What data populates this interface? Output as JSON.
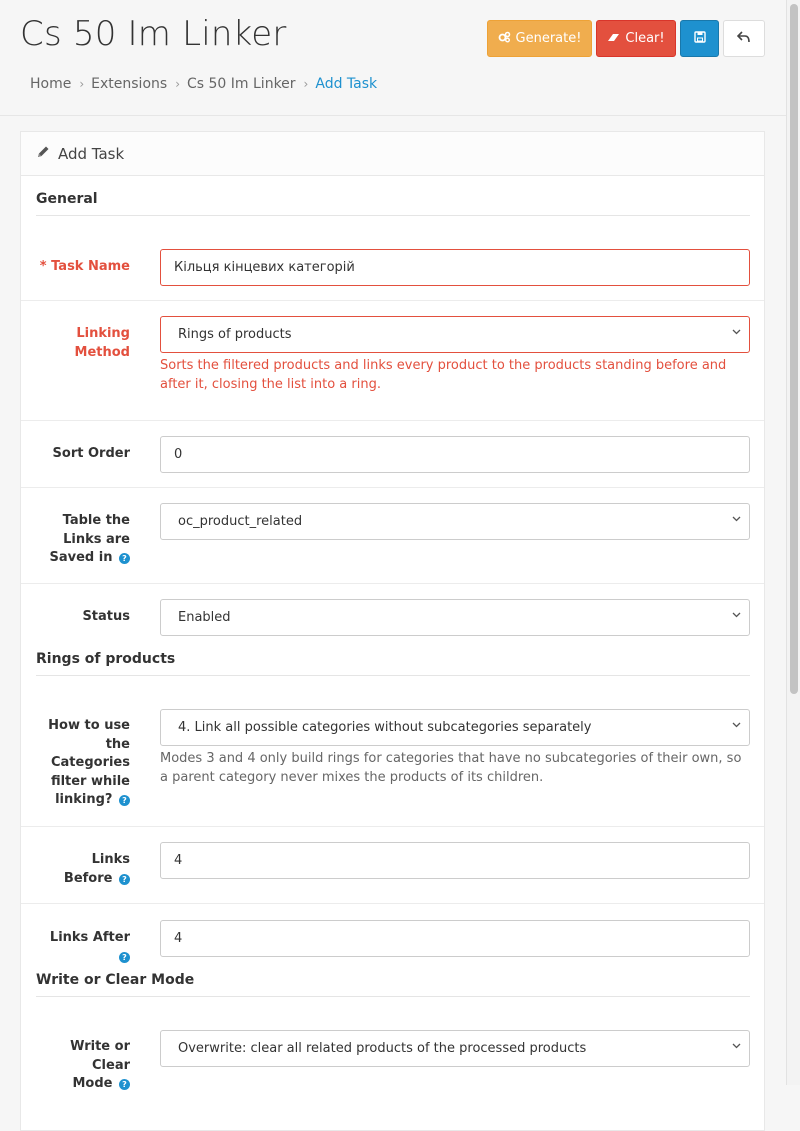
{
  "header": {
    "title": "Cs 50 Im Linker",
    "buttons": {
      "generate": "Generate!",
      "clear": "Clear!"
    },
    "breadcrumb": [
      "Home",
      "Extensions",
      "Cs 50 Im Linker",
      "Add Task"
    ]
  },
  "panel": {
    "heading": "Add Task",
    "sections": {
      "general": "General",
      "rings": "Rings of products",
      "write": "Write or Clear Mode"
    },
    "fields": {
      "task_name": {
        "label": "Task Name",
        "value": "Кільця кінцевих категорій"
      },
      "linking_method": {
        "label_line1": "Linking",
        "label_line2": "Method",
        "value": "Rings of products",
        "hint": "Sorts the filtered products and links every product to the products standing before and after it, closing the list into a ring."
      },
      "sort_order": {
        "label": "Sort Order",
        "value": "0"
      },
      "table": {
        "label_line1": "Table the",
        "label_line2": "Links are",
        "label_line3": "Saved in",
        "value": "oc_product_related"
      },
      "status": {
        "label": "Status",
        "value": "Enabled"
      },
      "categories_filter": {
        "label_line1": "How to use",
        "label_line2": "the",
        "label_line3": "Categories",
        "label_line4": "filter while",
        "label_line5": "linking?",
        "value": "4. Link all possible categories without subcategories separately",
        "hint": "Modes 3 and 4 only build rings for categories that have no subcategories of their own, so a parent category never mixes the products of its children."
      },
      "links_before": {
        "label_line1": "Links",
        "label_line2": "Before",
        "value": "4"
      },
      "links_after": {
        "label": "Links After",
        "value": "4"
      },
      "write_mode": {
        "label_line1": "Write or Clear",
        "label_line2": "Mode",
        "value": "Overwrite: clear all related products of the processed products"
      }
    }
  },
  "colors": {
    "warning": "#f0ad4e",
    "danger": "#e3503e",
    "primary": "#1e91cf",
    "error_text": "#e3503e"
  },
  "icons": {
    "generate": "cogs-icon",
    "clear": "eraser-icon",
    "save": "save-icon",
    "back": "reply-icon",
    "heading": "pencil-icon",
    "help": "question-circle-icon"
  }
}
